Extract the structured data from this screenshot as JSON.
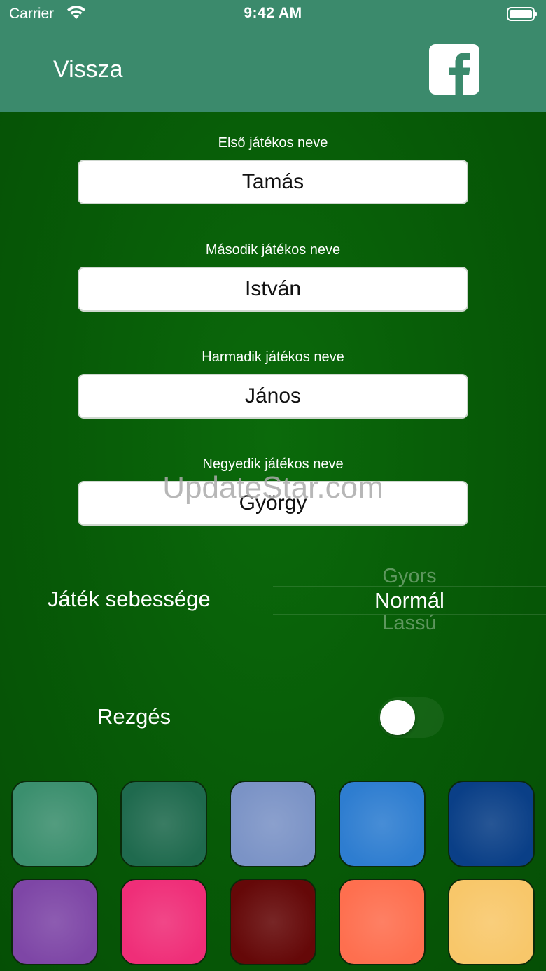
{
  "status_bar": {
    "carrier": "Carrier",
    "time": "9:42 AM",
    "wifi_icon": "wifi-icon",
    "battery_icon": "battery-icon"
  },
  "header": {
    "back_label": "Vissza",
    "facebook_icon": "facebook-icon",
    "background": "#3b8a6c"
  },
  "players": [
    {
      "label": "Első játékos neve",
      "value": "Tamás"
    },
    {
      "label": "Második játékos neve",
      "value": "István"
    },
    {
      "label": "Harmadik játékos neve",
      "value": "János"
    },
    {
      "label": "Negyedik játékos neve",
      "value": "György"
    }
  ],
  "watermark": "UpdateStar.com",
  "speed": {
    "label": "Játék sebessége",
    "options": [
      "Gyors",
      "Normál",
      "Lassú"
    ],
    "selected": "Normál"
  },
  "vibration": {
    "label": "Rezgés",
    "enabled": false
  },
  "theme_colors": [
    "#3b8f6e",
    "#1f6a4e",
    "#7b93c6",
    "#2e7dd0",
    "#0a3f87",
    "#7e46a6",
    "#ef2e78",
    "#650808",
    "#fe6f4f",
    "#f8c76a"
  ],
  "background": "#075a07"
}
